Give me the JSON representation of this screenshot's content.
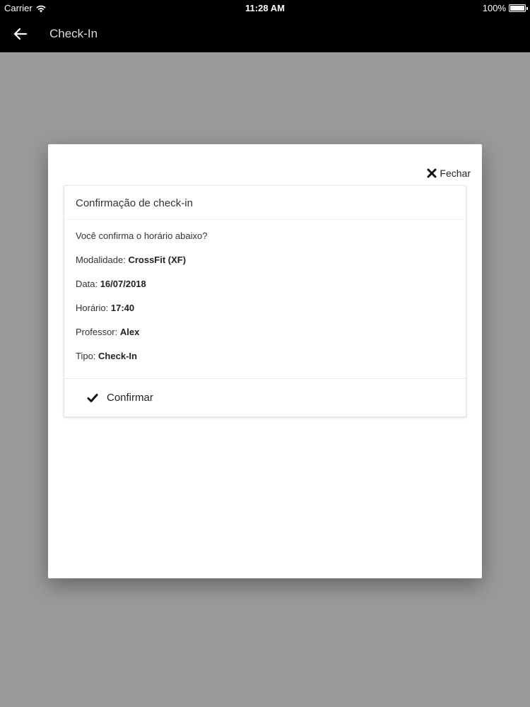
{
  "status_bar": {
    "carrier": "Carrier",
    "time": "11:28 AM",
    "battery": "100%"
  },
  "nav": {
    "title": "Check-In",
    "back_icon": "arrow-left-icon"
  },
  "modal": {
    "close_label": "Fechar",
    "close_icon": "close-icon",
    "card": {
      "title": "Confirmação de check-in",
      "question": "Você confirma o horário abaixo?",
      "fields": [
        {
          "label": "Modalidade:",
          "value": "CrossFit (XF)"
        },
        {
          "label": "Data:",
          "value": "16/07/2018"
        },
        {
          "label": "Horário:",
          "value": "17:40"
        },
        {
          "label": "Professor:",
          "value": "Alex"
        },
        {
          "label": "Tipo:",
          "value": "Check-In"
        }
      ],
      "confirm_label": "Confirmar",
      "confirm_icon": "check-icon"
    }
  }
}
